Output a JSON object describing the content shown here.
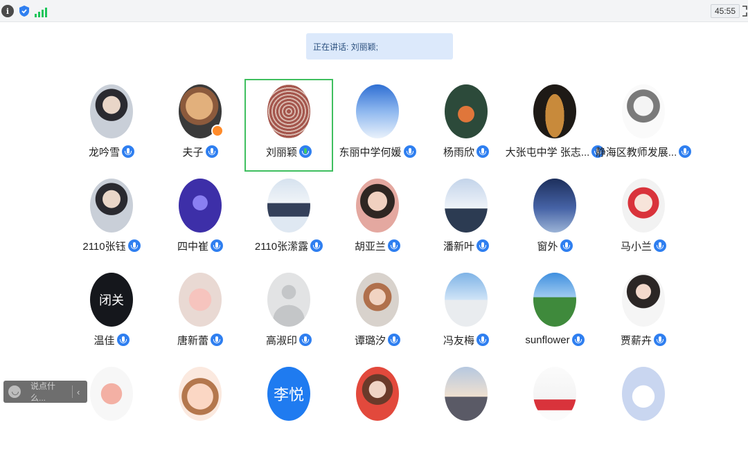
{
  "toolbar": {
    "timer": "45:55",
    "info_icon": "info-icon",
    "shield_icon": "shield-icon",
    "signal_icon": "signal-icon",
    "expand_icon": "expand-icon"
  },
  "speaking": {
    "label": "正在讲话: 刘丽颖;"
  },
  "participants": [
    {
      "name": "龙吟雪",
      "avatar": "photo-portrait"
    },
    {
      "name": "夫子",
      "avatar": "photo-child"
    },
    {
      "name": "刘丽颖",
      "avatar": "seal-logo",
      "speaking": true
    },
    {
      "name": "东丽中学何媛",
      "avatar": "photo-sky"
    },
    {
      "name": "杨雨欣",
      "avatar": "photo-fox"
    },
    {
      "name": "大张屯中学 张志...",
      "avatar": "photo-gourd"
    },
    {
      "name": "静海区教师发展...",
      "avatar": "sketch-portrait"
    },
    {
      "name": "2110张钰",
      "avatar": "photo-portrait"
    },
    {
      "name": "四中崔",
      "avatar": "photo-purple"
    },
    {
      "name": "2110张潆露",
      "avatar": "photo-snow"
    },
    {
      "name": "胡亚兰",
      "avatar": "photo-woman"
    },
    {
      "name": "潘新叶",
      "avatar": "photo-snow-figure"
    },
    {
      "name": "窗外",
      "avatar": "photo-lighthouse"
    },
    {
      "name": "马小兰",
      "avatar": "cartoon-girl"
    },
    {
      "name": "温佳",
      "avatar": "dark-text-logo",
      "avatar_text": "闭关"
    },
    {
      "name": "唐新蕾",
      "avatar": "plush-bunny"
    },
    {
      "name": "高淑印",
      "avatar": "default-avatar"
    },
    {
      "name": "谭璐汐",
      "avatar": "photo-baby"
    },
    {
      "name": "冯友梅",
      "avatar": "photo-boy"
    },
    {
      "name": "sunflower",
      "avatar": "photo-field"
    },
    {
      "name": "贾薪卉",
      "avatar": "photo-girl"
    },
    {
      "name": "",
      "avatar": "cartoon-sticker"
    },
    {
      "name": "",
      "avatar": "cartoon-face"
    },
    {
      "name": "",
      "avatar": "text-avatar",
      "avatar_text": "李悦"
    },
    {
      "name": "",
      "avatar": "photo-woman-red"
    },
    {
      "name": "",
      "avatar": "photo-sunset"
    },
    {
      "name": "",
      "avatar": "card-red"
    },
    {
      "name": "",
      "avatar": "cartoon-bear"
    }
  ],
  "chat": {
    "placeholder": "说点什么...",
    "smile_icon": "smile-icon",
    "collapse_icon": "chevron-left-icon"
  }
}
